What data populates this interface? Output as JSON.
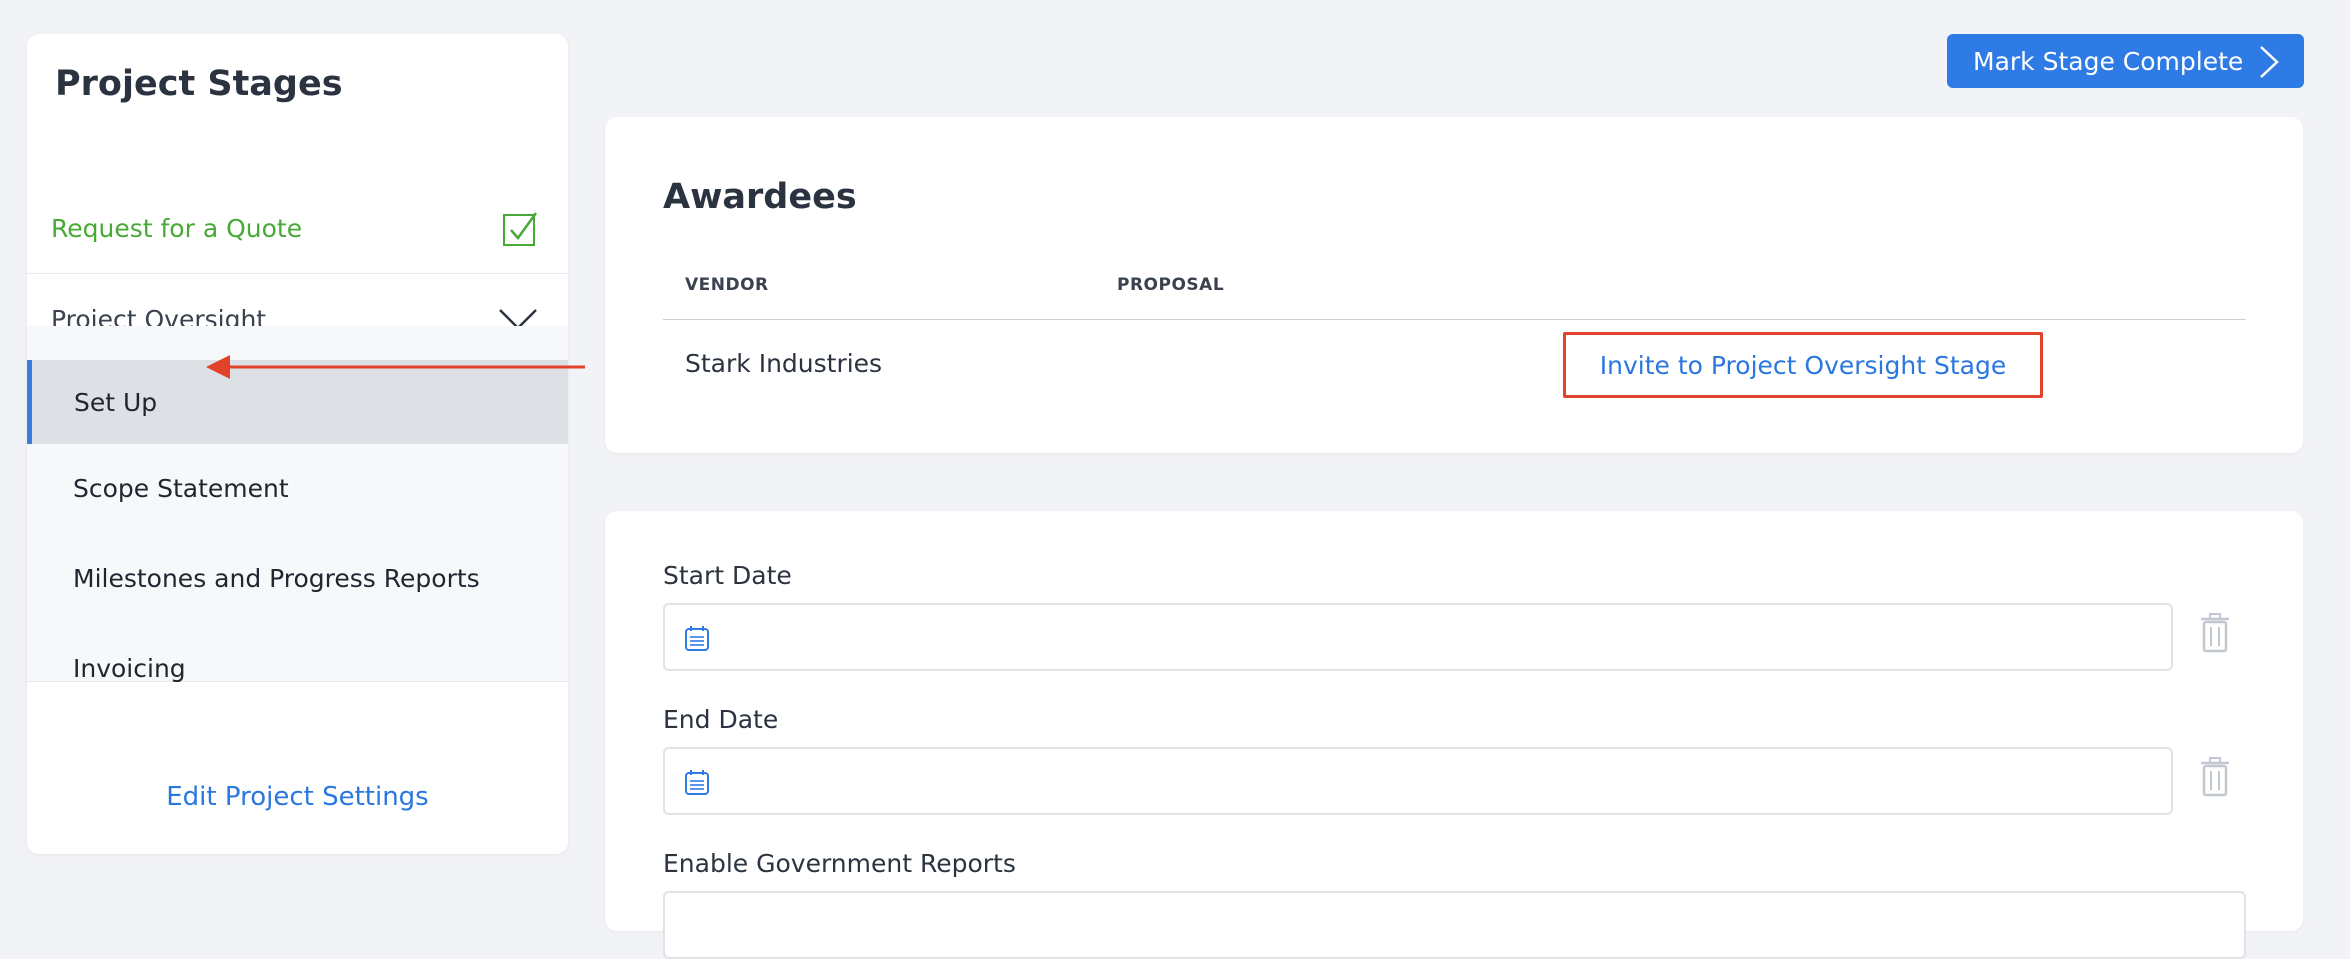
{
  "sidebar": {
    "title": "Project Stages",
    "stages": [
      {
        "label": "Request for a Quote",
        "status": "complete"
      },
      {
        "label": "Project Oversight",
        "status": "expanded"
      }
    ],
    "substages": [
      {
        "label": "Set Up",
        "active": true
      },
      {
        "label": "Scope Statement",
        "active": false
      },
      {
        "label": "Milestones and Progress Reports",
        "active": false
      },
      {
        "label": "Invoicing",
        "active": false
      }
    ],
    "edit_link": "Edit Project Settings"
  },
  "toolbar": {
    "mark_complete_label": "Mark Stage Complete"
  },
  "awardees": {
    "title": "Awardees",
    "columns": [
      "VENDOR",
      "PROPOSAL"
    ],
    "rows": [
      {
        "vendor": "Stark Industries",
        "action": "Invite to Project Oversight Stage"
      }
    ]
  },
  "dates": {
    "start_label": "Start Date",
    "end_label": "End Date",
    "gov_reports_label": "Enable Government Reports"
  },
  "colors": {
    "accent": "#2f7be6",
    "success": "#47a936",
    "highlight": "#e2422a"
  },
  "icons": [
    "checkbox-checked-icon",
    "chevron-down-icon",
    "chevron-right-icon",
    "calendar-icon",
    "trash-icon"
  ]
}
